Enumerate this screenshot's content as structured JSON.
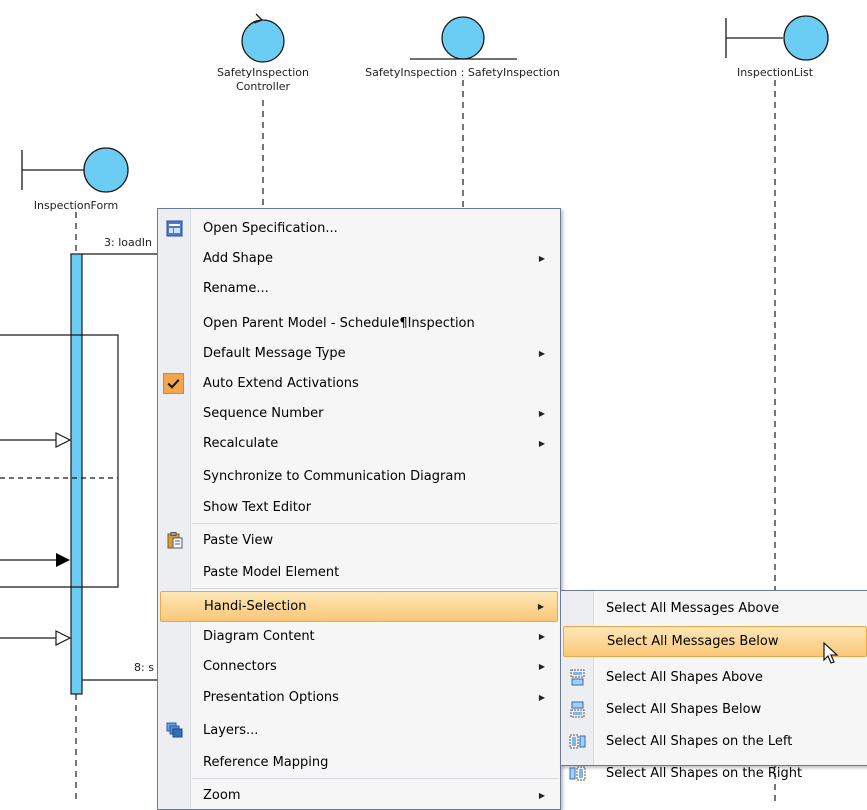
{
  "diagram": {
    "lifelines": [
      {
        "id": "controller",
        "label_line1": "SafetyInspection",
        "label_line2": "Controller",
        "type": "control"
      },
      {
        "id": "entity",
        "label_line1": "SafetyInspection : SafetyInspection",
        "label_line2": "",
        "type": "entity"
      },
      {
        "id": "list",
        "label_line1": "InspectionList",
        "label_line2": "",
        "type": "boundary"
      },
      {
        "id": "form",
        "label_line1": "InspectionForm",
        "label_line2": "",
        "type": "boundary"
      }
    ],
    "messages": [
      {
        "label": "3: loadIn"
      },
      {
        "label": "8: s"
      }
    ]
  },
  "context_menu": {
    "items": [
      {
        "label": "Open Specification...",
        "icon": "specification-icon",
        "submenu": false
      },
      {
        "label": "Add Shape",
        "icon": "",
        "submenu": true
      },
      {
        "label": "Rename...",
        "icon": "",
        "submenu": false
      },
      {
        "label": "Open Parent Model - Schedule¶Inspection",
        "icon": "",
        "submenu": false
      },
      {
        "label": "Default Message Type",
        "icon": "",
        "submenu": true
      },
      {
        "label": "Auto Extend Activations",
        "icon": "checkmark-icon",
        "submenu": false,
        "checked": true
      },
      {
        "label": "Sequence Number",
        "icon": "",
        "submenu": true
      },
      {
        "label": "Recalculate",
        "icon": "",
        "submenu": true
      },
      {
        "label": "Synchronize to Communication Diagram",
        "icon": "",
        "submenu": false
      },
      {
        "label": "Show Text Editor",
        "icon": "",
        "submenu": false
      },
      {
        "label": "Paste View",
        "icon": "clipboard-icon",
        "submenu": false
      },
      {
        "label": "Paste Model Element",
        "icon": "",
        "submenu": false
      },
      {
        "label": "Handi-Selection",
        "icon": "",
        "submenu": true,
        "highlighted": true
      },
      {
        "label": "Diagram Content",
        "icon": "",
        "submenu": true
      },
      {
        "label": "Connectors",
        "icon": "",
        "submenu": true
      },
      {
        "label": "Presentation Options",
        "icon": "",
        "submenu": true
      },
      {
        "label": "Layers...",
        "icon": "layers-icon",
        "submenu": false
      },
      {
        "label": "Reference Mapping",
        "icon": "",
        "submenu": false
      },
      {
        "label": "Zoom",
        "icon": "",
        "submenu": true
      }
    ]
  },
  "submenu": {
    "items": [
      {
        "label": "Select All Messages Above",
        "icon": ""
      },
      {
        "label": "Select All Messages Below",
        "icon": "",
        "highlighted": true
      },
      {
        "label": "Select All Shapes Above",
        "icon": "select-shapes-above-icon"
      },
      {
        "label": "Select All Shapes Below",
        "icon": "select-shapes-below-icon"
      },
      {
        "label": "Select All Shapes on the Left",
        "icon": "select-shapes-left-icon"
      },
      {
        "label": "Select All Shapes on the Right",
        "icon": "select-shapes-right-icon"
      }
    ]
  },
  "colors": {
    "lifeline_fill": "#6ccdf4",
    "menu_highlight": "#f9c777",
    "check_bg": "#f4a64c"
  },
  "cursor": "mouse-pointer-icon"
}
